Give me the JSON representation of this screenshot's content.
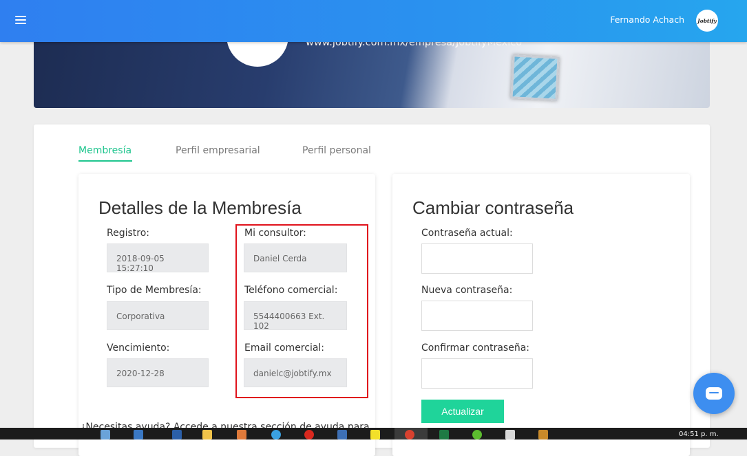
{
  "header": {
    "user_name": "Fernando Achach",
    "avatar_text": "Jobtify"
  },
  "banner": {
    "url": "www.jobtify.com.mx/empresa/JobtifyMexico"
  },
  "tabs": [
    {
      "label": "Membresía",
      "active": true
    },
    {
      "label": "Perfil empresarial",
      "active": false
    },
    {
      "label": "Perfil personal",
      "active": false
    }
  ],
  "membership": {
    "title": "Detalles de la Membresía",
    "registro_label": "Registro:",
    "registro_value": "2018-09-05 15:27:10",
    "tipo_label": "Tipo de Membresía:",
    "tipo_value": "Corporativa",
    "vencimiento_label": "Vencimiento:",
    "vencimiento_value": "2020-12-28",
    "consultor_label": "Mi consultor:",
    "consultor_value": "Daniel Cerda",
    "telefono_label": "Teléfono comercial:",
    "telefono_value": "5544400663 Ext. 102",
    "email_label": "Email comercial:",
    "email_value": "danielc@jobtify.mx",
    "help_text": "¿Necesitas ayuda? Accede a nuestra sección de ayuda para"
  },
  "password": {
    "title": "Cambiar contraseña",
    "current_label": "Contraseña actual:",
    "new_label": "Nueva contraseña:",
    "confirm_label": "Confirmar contraseña:",
    "update_button": "Actualizar"
  },
  "taskbar": {
    "clock": "04:51 p. m."
  },
  "colors": {
    "accent": "#1fc58e",
    "button": "#1fd49a",
    "header": "#2f7ff0",
    "highlight_border": "#e0121b"
  }
}
